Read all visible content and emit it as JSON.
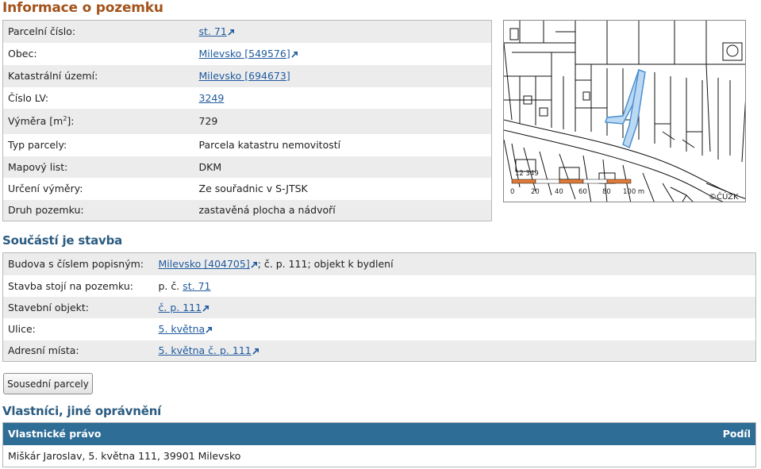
{
  "title": "Informace o pozemku",
  "parcel": [
    {
      "label": "Parcelní číslo:",
      "value": "st. 71",
      "link": true,
      "ext": true
    },
    {
      "label": "Obec:",
      "value": "Milevsko [549576]",
      "link": true,
      "ext": true
    },
    {
      "label": "Katastrální území:",
      "value": "Milevsko [694673]",
      "link": true,
      "ext": false
    },
    {
      "label": "Číslo LV:",
      "value": "3249",
      "link": true,
      "ext": false
    },
    {
      "label_main": "Výměra [m",
      "label_sup": "2",
      "label_tail": "]:",
      "value": "729",
      "link": false
    },
    {
      "label": "Typ parcely:",
      "value": "Parcela katastru nemovitostí",
      "link": false
    },
    {
      "label": "Mapový list:",
      "value": "DKM",
      "link": false
    },
    {
      "label": "Určení výměry:",
      "value": "Ze souřadnic v S-JTSK",
      "link": false
    },
    {
      "label": "Druh pozemku:",
      "value": "zastavěná plocha a nádvoří",
      "link": false
    }
  ],
  "map": {
    "label": "12 349",
    "scale": [
      "0",
      "20",
      "40",
      "60",
      "80",
      "100 m"
    ],
    "copyright": "©ČÚZK"
  },
  "building_section_title": "Součástí je stavba",
  "building": [
    {
      "label": "Budova s číslem popisným:",
      "link_text": "Milevsko [404705]",
      "ext": true,
      "suffix": "; č. p. 111; objekt k bydlení"
    },
    {
      "label": "Stavba stojí na pozemku:",
      "prefix": "p. č. ",
      "link_text": "st. 71",
      "ext": false
    },
    {
      "label": "Stavební objekt:",
      "link_text": "č. p. 111",
      "ext": true
    },
    {
      "label": "Ulice:",
      "link_text": "5. května",
      "ext": true
    },
    {
      "label": "Adresní místa:",
      "link_text": "5. května č. p. 111",
      "ext": true
    }
  ],
  "neighbors_button": "Sousední parcely",
  "owners_section_title": "Vlastníci, jiné oprávnění",
  "owners": {
    "header_left": "Vlastnické právo",
    "header_right": "Podíl",
    "rows": [
      {
        "name": "Miškár Jaroslav, 5. května 111, 39901 Milevsko",
        "share": ""
      }
    ]
  }
}
